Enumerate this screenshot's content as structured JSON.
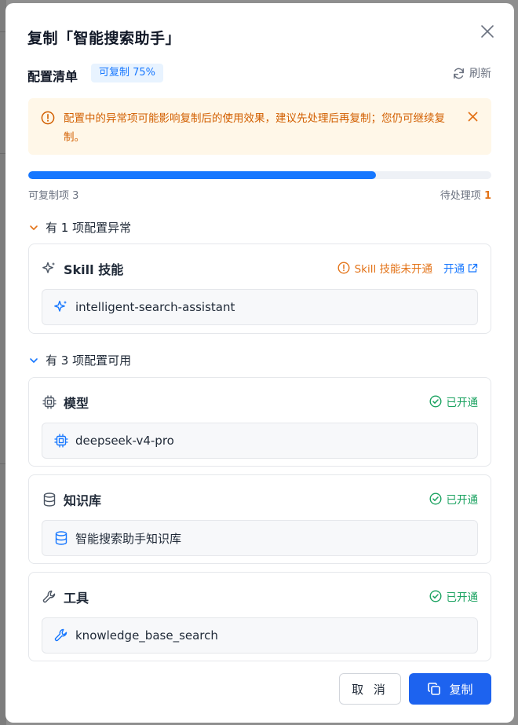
{
  "modal": {
    "title": "复制「智能搜索助手」",
    "subtitle": "配置清单",
    "badge": "可复制 75%",
    "refresh_label": "刷新"
  },
  "warning": {
    "text": "配置中的异常项可能影响复制后的使用效果，建议先处理后再复制；您仍可继续复制。"
  },
  "progress": {
    "percent": 75,
    "left_label": "可复制项 3",
    "right_label": "待处理项",
    "pending_count": "1"
  },
  "groups": [
    {
      "label": "有 1 项配置异常",
      "cards": [
        {
          "title": "Skill 技能",
          "status": "Skill 技能未开通",
          "action": "开通",
          "item": "intelligent-search-assistant"
        }
      ]
    },
    {
      "label": "有 3 项配置可用",
      "cards": [
        {
          "title": "模型",
          "status": "已开通",
          "item": "deepseek-v4-pro"
        },
        {
          "title": "知识库",
          "status": "已开通",
          "item": "智能搜索助手知识库"
        },
        {
          "title": "工具",
          "status": "已开通",
          "item": "knowledge_base_search"
        }
      ]
    }
  ],
  "footer": {
    "cancel_label": "取 消",
    "copy_label": "复制"
  },
  "colors": {
    "primary": "#1677ff",
    "warning": "#e37318",
    "success": "#1aa260",
    "warning_bg": "#fff7e8"
  }
}
